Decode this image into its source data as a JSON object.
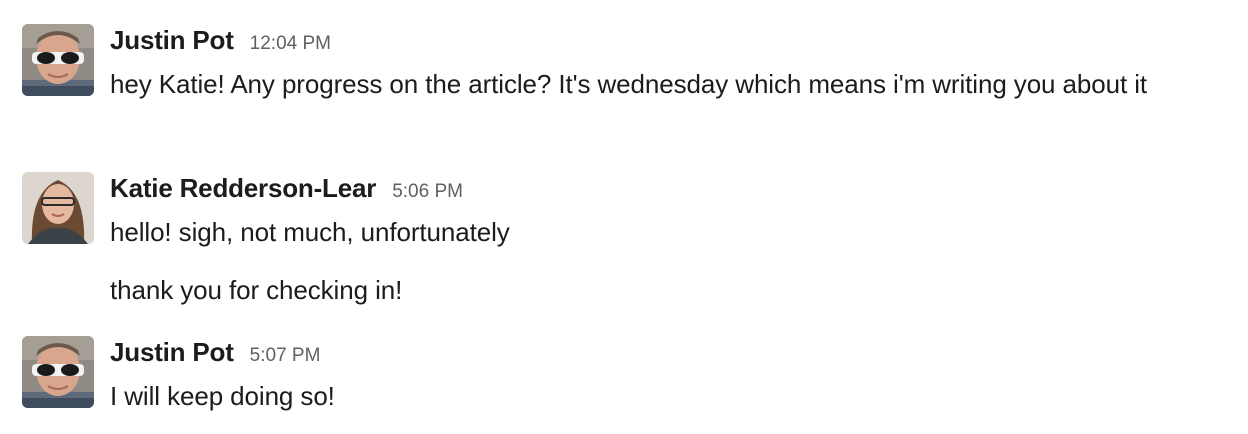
{
  "colors": {
    "name": "#1d1c1d",
    "timestamp": "#616061",
    "text": "#1d1c1d",
    "background": "#ffffff"
  },
  "messages": [
    {
      "sender": "Justin Pot",
      "time": "12:04 PM",
      "avatar": "avatar-justin-sunglasses",
      "lines": [
        "hey Katie! Any progress on the article? It's wednesday which means i'm writing you about it"
      ]
    },
    {
      "sender": "Katie Redderson-Lear",
      "time": "5:06 PM",
      "avatar": "avatar-katie-glasses",
      "lines": [
        "hello! sigh, not much, unfortunately",
        "thank you for checking in!"
      ]
    },
    {
      "sender": "Justin Pot",
      "time": "5:07 PM",
      "avatar": "avatar-justin-sunglasses",
      "lines": [
        "I will keep doing so!"
      ]
    }
  ]
}
